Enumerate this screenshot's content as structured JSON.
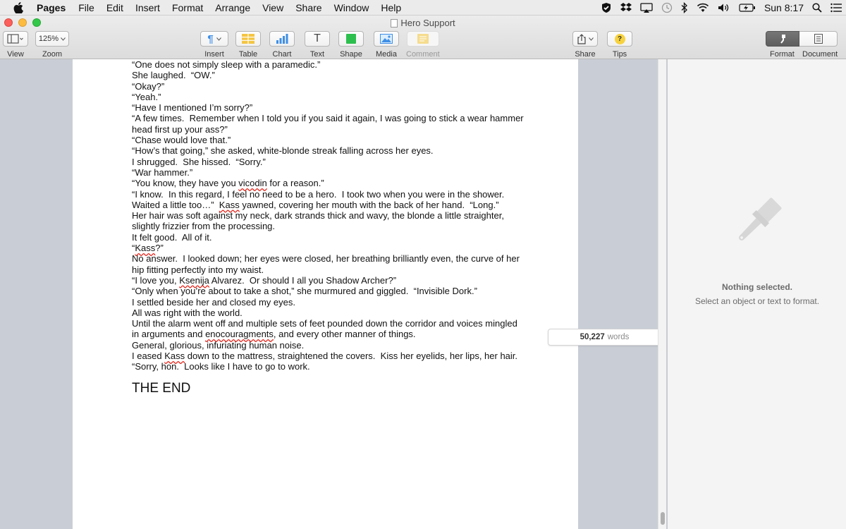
{
  "menubar": {
    "app": "Pages",
    "items": [
      "File",
      "Edit",
      "Insert",
      "Format",
      "Arrange",
      "View",
      "Share",
      "Window",
      "Help"
    ],
    "clock": "Sun 8:17"
  },
  "window": {
    "title": "Hero Support"
  },
  "toolbar": {
    "view_label": "View",
    "zoom_value": "125%",
    "zoom_label": "Zoom",
    "insert_label": "Insert",
    "table_label": "Table",
    "chart_label": "Chart",
    "text_label": "Text",
    "text_glyph": "T",
    "shape_label": "Shape",
    "media_label": "Media",
    "comment_label": "Comment",
    "share_label": "Share",
    "tips_label": "Tips",
    "tips_glyph": "?",
    "format_label": "Format",
    "document_label": "Document"
  },
  "document": {
    "lines": [
      "“One does not simply sleep with a paramedic.”",
      "She laughed.  “OW.”",
      "“Okay?”",
      "“Yeah.”",
      "“Have I mentioned I’m sorry?”",
      "“A few times.  Remember when I told you if you said it again, I was going to stick a wear hammer head first up your ass?”",
      "“Chase would love that.”",
      "“How’s that going,” she asked, white-blonde streak falling across her eyes.",
      "I shrugged.  She hissed.  “Sorry.”",
      "“War hammer.”",
      "“You know, they have you vicodin for a reason.”",
      "“I know.  In this regard, I feel no need to be a hero.  I took two when you were in the shower.  Waited a little too…”  Kass yawned, covering her mouth with the back of her hand.  “Long.”",
      "Her hair was soft against my neck, dark strands thick and wavy, the blonde a little straighter, slightly frizzier from the processing.",
      "It felt good.  All of it.",
      "“Kass?”",
      "No answer.  I looked down; her eyes were closed, her breathing brilliantly even, the curve of her hip fitting perfectly into my waist.",
      "“I love you, Ksenija Alvarez.  Or should I all you Shadow Archer?”",
      "“Only when you’re about to take a shot,” she murmured and giggled.  “Invisible Dork.”",
      "I settled beside her and closed my eyes.",
      "All was right with the world.",
      "Until the alarm went off and multiple sets of feet pounded down the corridor and voices mingled in arguments and enocouragments, and every other manner of things.",
      "General, glorious, infuriating human noise.",
      "I eased Kass down to the mattress, straightened the covers.  Kiss her eyelids, her lips, her hair.",
      "“Sorry, hon.  Looks like I have to go to work."
    ],
    "misspelled": [
      "vicodin",
      "Kass",
      "Ksenija",
      "enocouragments"
    ],
    "the_end": "THE END"
  },
  "wordcount": {
    "value": "50,227",
    "unit": "words"
  },
  "inspector": {
    "title": "Nothing selected.",
    "subtitle": "Select an object or text to format."
  },
  "colors": {
    "accent_green": "#2dbf4e",
    "accent_blue": "#3f8fe6",
    "comment_yellow": "#f4d36b",
    "spell_red": "#e0281e"
  }
}
